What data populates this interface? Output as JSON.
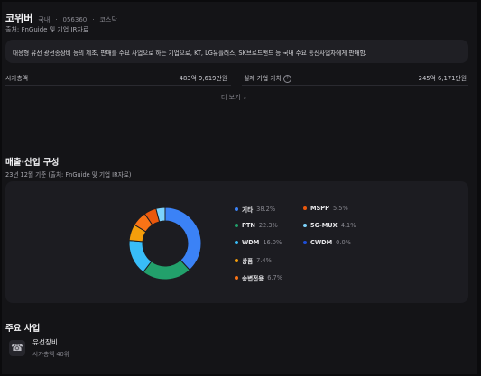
{
  "company": {
    "name": "코위버",
    "market": "국내",
    "code": "056360",
    "exchange": "코스닥",
    "source": "출처: FnGuide 및 기업 IR자료",
    "description": "대응형 유선 광전송장비 등의 제조, 판매를 주요 사업으로 하는 기업으로, KT, LG유플러스, SK브로드밴드 등 국내 주요 통신사업자에게 판매함."
  },
  "stats": {
    "market_cap_label": "시가총액",
    "market_cap_value": "483억 9,619만원",
    "ev_label": "실제 기업 가치",
    "ev_value": "245억 6,171만원"
  },
  "more_label": "더 보기",
  "revenue_section": {
    "title": "매출·산업 구성",
    "subtitle": "23년 12월 기준 (출처: FnGuide 및 기업 IR자료)"
  },
  "chart_data": {
    "type": "pie",
    "style": "donut",
    "legend_position": "right",
    "slices": [
      {
        "name": "기타",
        "pct_label": "38.2%",
        "value": 38.2,
        "color": "#3b82f6"
      },
      {
        "name": "PTN",
        "pct_label": "22.3%",
        "value": 22.3,
        "color": "#22a06b"
      },
      {
        "name": "WDM",
        "pct_label": "16.0%",
        "value": 16.0,
        "color": "#38bdf8"
      },
      {
        "name": "상품",
        "pct_label": "7.4%",
        "value": 7.4,
        "color": "#f59e0b"
      },
      {
        "name": "송변전용",
        "pct_label": "6.7%",
        "value": 6.7,
        "color": "#f97316"
      },
      {
        "name": "MSPP",
        "pct_label": "5.5%",
        "value": 5.5,
        "color": "#ea580c"
      },
      {
        "name": "5G-MUX",
        "pct_label": "4.1%",
        "value": 4.1,
        "color": "#7dd3fc"
      },
      {
        "name": "CWDM",
        "pct_label": "0.0%",
        "value": 0.0,
        "color": "#1d4ed8"
      }
    ]
  },
  "business_section": {
    "title": "주요 사업",
    "items": [
      {
        "name": "유선장비",
        "sub": "시가총액 40위",
        "icon": "telephone-icon"
      }
    ]
  },
  "colors": {
    "background": "#141417",
    "card": "#1c1c21"
  }
}
